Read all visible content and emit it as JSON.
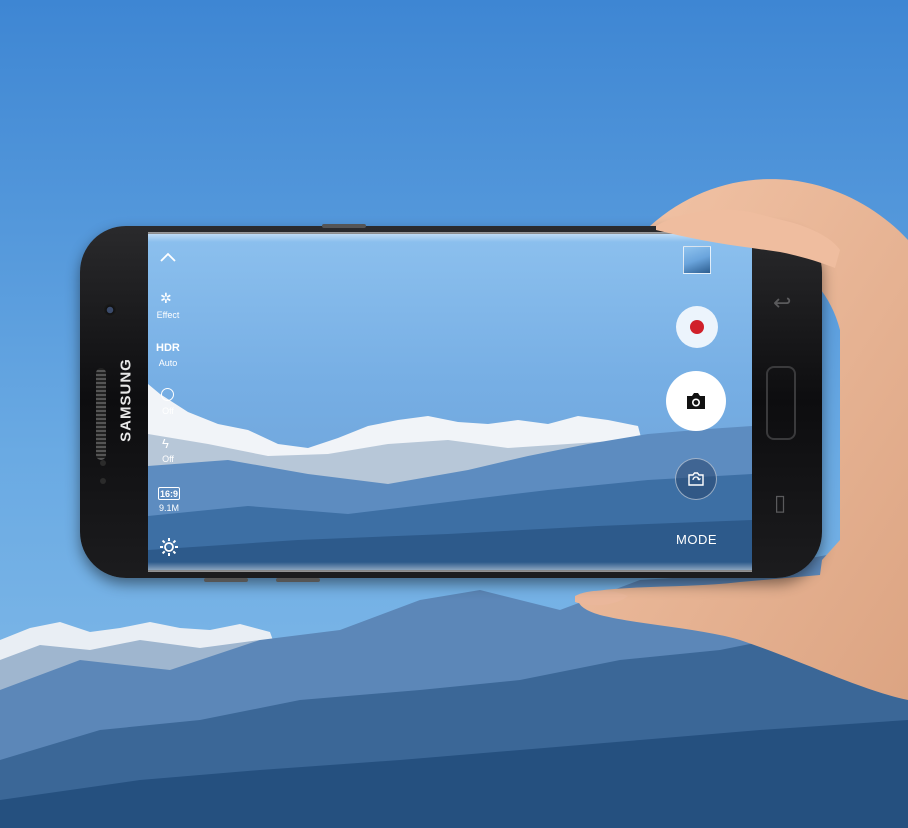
{
  "device": {
    "brand": "SAMSUNG"
  },
  "camera_ui": {
    "settings_expand_icon": "chevron-up-icon",
    "effects": {
      "icon": "sparkle-icon",
      "label": "Effect"
    },
    "hdr": {
      "icon_text": "HDR",
      "label": "Auto"
    },
    "timer": {
      "icon": "timer-icon",
      "label": "Off"
    },
    "flash": {
      "icon": "flash-icon",
      "label": "Off"
    },
    "picture_size": {
      "ratio": "16:9",
      "megapixels": "9.1M"
    },
    "settings": {
      "icon": "gear-icon"
    },
    "gallery_thumbnail": {
      "icon": "gallery-thumbnail"
    },
    "record_button": {
      "icon": "record-icon",
      "accent": "#d0202a"
    },
    "capture_button": {
      "icon": "camera-icon"
    },
    "switch_camera": {
      "icon": "switch-camera-icon"
    },
    "mode_label": "MODE"
  },
  "colors": {
    "sky": "#4a8fd6",
    "screen_sky": "#8cc0ee",
    "record_red": "#d0202a"
  }
}
